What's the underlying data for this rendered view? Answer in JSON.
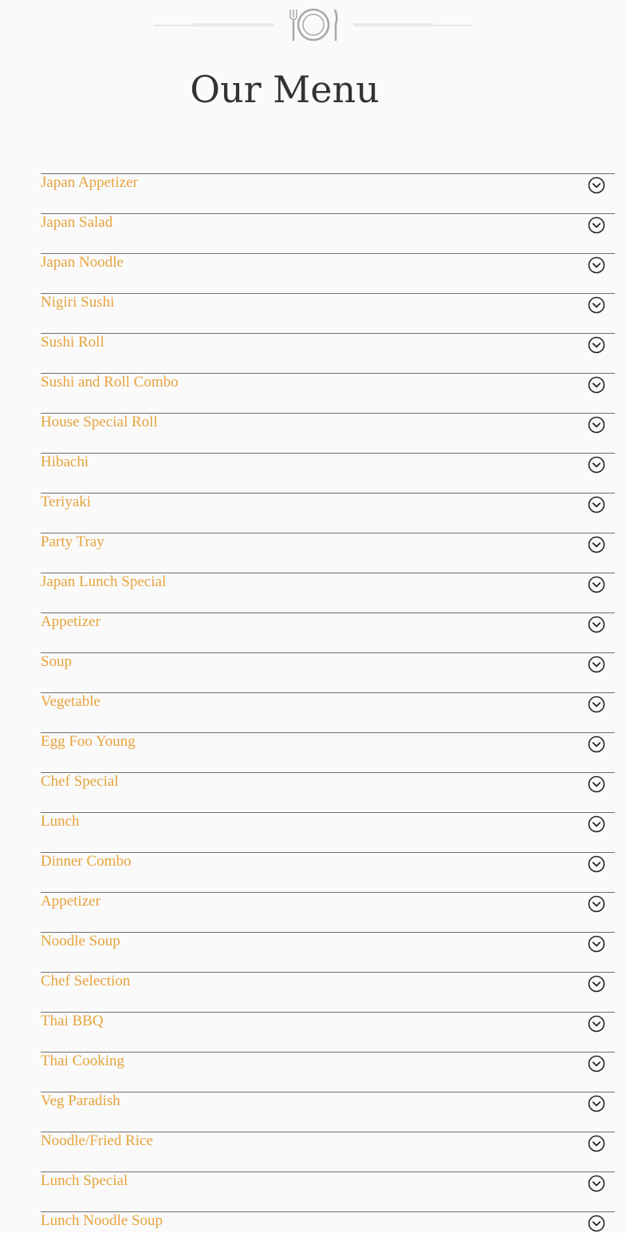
{
  "header": {
    "title": "Our Menu",
    "ornament_icon": "plate-fork-knife-icon"
  },
  "colors": {
    "background": "#fafafa",
    "title": "#333333",
    "item_label": "#e8a33c",
    "divider": "#6e6e6e",
    "icon": "#222222"
  },
  "menu": {
    "expand_icon": "chevron-down-circle-icon",
    "items": [
      {
        "label": "Japan Appetizer"
      },
      {
        "label": "Japan Salad"
      },
      {
        "label": "Japan Noodle"
      },
      {
        "label": "Nigiri Sushi"
      },
      {
        "label": "Sushi Roll"
      },
      {
        "label": "Sushi and Roll Combo"
      },
      {
        "label": "House Special Roll"
      },
      {
        "label": "Hibachi"
      },
      {
        "label": "Teriyaki"
      },
      {
        "label": "Party Tray"
      },
      {
        "label": "Japan Lunch Special"
      },
      {
        "label": "Appetizer"
      },
      {
        "label": "Soup"
      },
      {
        "label": "Vegetable"
      },
      {
        "label": "Egg Foo Young"
      },
      {
        "label": "Chef Special"
      },
      {
        "label": "Lunch"
      },
      {
        "label": "Dinner Combo"
      },
      {
        "label": "Appetizer"
      },
      {
        "label": "Noodle Soup"
      },
      {
        "label": "Chef Selection"
      },
      {
        "label": "Thai BBQ"
      },
      {
        "label": "Thai Cooking"
      },
      {
        "label": "Veg Paradish"
      },
      {
        "label": "Noodle/Fried Rice"
      },
      {
        "label": "Lunch Special"
      },
      {
        "label": "Lunch Noodle Soup"
      }
    ]
  }
}
